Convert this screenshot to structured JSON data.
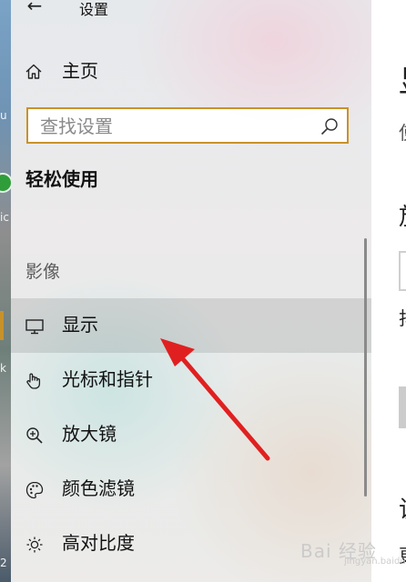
{
  "window": {
    "title": "设置",
    "back_glyph": "←"
  },
  "nav": {
    "home_label": "主页",
    "search_placeholder": "查找设置",
    "section_heading": "轻松使用",
    "group_label": "影像",
    "items": [
      {
        "label": "显示",
        "icon": "monitor-icon",
        "selected": true
      },
      {
        "label": "光标和指针",
        "icon": "pointer-hand-icon",
        "selected": false
      },
      {
        "label": "放大镜",
        "icon": "magnifier-icon",
        "selected": false
      },
      {
        "label": "颜色滤镜",
        "icon": "palette-icon",
        "selected": false
      },
      {
        "label": "高对比度",
        "icon": "sun-contrast-icon",
        "selected": false
      }
    ]
  },
  "content_fragments": [
    "显",
    "使",
    "放",
    "抖",
    "调",
    "更"
  ],
  "desktop_fragments": [
    "u",
    "ic",
    "k",
    "2"
  ],
  "watermark": {
    "text": "Bai 经验",
    "sub": "jingyan.baidu.com"
  },
  "colors": {
    "search_border": "#c8922a",
    "accent": "#c8922a",
    "annotation_arrow": "#e02020"
  }
}
